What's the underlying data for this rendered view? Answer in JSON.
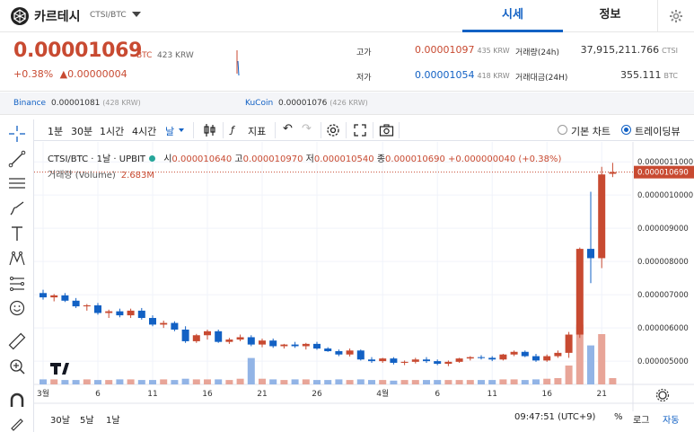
{
  "header": {
    "coin_name": "카르테시",
    "pair": "CTSI/BTC",
    "tab_market": "시세",
    "tab_info": "정보"
  },
  "price": {
    "current": "0.00001069",
    "unit": "BTC",
    "krw": "423 KRW",
    "change_pct": "+0.38%",
    "change_abs": "▲0.00000004"
  },
  "stats": {
    "high_label": "고가",
    "high_value": "0.00001097",
    "high_krw": "435 KRW",
    "low_label": "저가",
    "low_value": "0.00001054",
    "low_krw": "418 KRW",
    "volume_label": "거래량(24h)",
    "volume_value": "37,915,211.766",
    "volume_unit": "CTSI",
    "amount_label": "거래대금(24H)",
    "amount_value": "355.111",
    "amount_unit": "BTC"
  },
  "exchanges": [
    {
      "name": "Binance",
      "value": "0.00001081",
      "krw": "(428 KRW)"
    },
    {
      "name": "KuCoin",
      "value": "0.00001076",
      "krw": "(426 KRW)"
    }
  ],
  "toolbar": {
    "intervals": [
      "1분",
      "30분",
      "1시간",
      "4시간",
      "날"
    ],
    "indicators": "지표",
    "basic_chart": "기본 차트",
    "tradingview": "트레이딩뷰"
  },
  "legend": {
    "symbol": "CTSI/BTC · 1날 · UPBIT",
    "open_label": "시",
    "open": "0.000010640",
    "high_label": "고",
    "high": "0.000010970",
    "low_label": "저",
    "low": "0.000010540",
    "close_label": "종",
    "close": "0.000010690",
    "change": "+0.000000040 (+0.38%)",
    "volume_label": "거래량 (Volume)",
    "volume_value": "2.683M"
  },
  "bottom": {
    "ranges": [
      "30날",
      "5날",
      "1날"
    ],
    "time": "09:47:51 (UTC+9)",
    "pct": "%",
    "log": "로그",
    "auto": "자동"
  },
  "chart_data": {
    "type": "candlestick",
    "y_ticks": [
      "0.0000011000",
      "0.0000010000",
      "0.000009000",
      "0.000008000",
      "0.000007000",
      "0.000006000",
      "0.000005000"
    ],
    "y_tick_values": [
      11.0,
      10.0,
      9.0,
      8.0,
      7.0,
      6.0,
      5.0
    ],
    "last_price_label": "0.000010690",
    "last_price": 10.69,
    "x_tick_labels": [
      "3월",
      "6",
      "11",
      "16",
      "21",
      "26",
      "4월",
      "6",
      "11",
      "16",
      "21"
    ],
    "x_tick_days": [
      1,
      6,
      11,
      16,
      21,
      26,
      32,
      37,
      42,
      47,
      52
    ],
    "ylim": [
      4.3,
      11.6
    ],
    "units_note": "y values are in units of 1e-6 BTC",
    "up_color": "#c84a31",
    "down_color": "#1261c4",
    "candles": [
      [
        0,
        7.05,
        7.15,
        6.85,
        6.92
      ],
      [
        1,
        6.92,
        7.02,
        6.8,
        6.98
      ],
      [
        2,
        6.98,
        7.05,
        6.78,
        6.82
      ],
      [
        3,
        6.82,
        6.9,
        6.6,
        6.65
      ],
      [
        4,
        6.65,
        6.72,
        6.52,
        6.68
      ],
      [
        5,
        6.68,
        6.75,
        6.4,
        6.45
      ],
      [
        6,
        6.45,
        6.55,
        6.3,
        6.5
      ],
      [
        7,
        6.5,
        6.58,
        6.32,
        6.38
      ],
      [
        8,
        6.38,
        6.58,
        6.3,
        6.52
      ],
      [
        9,
        6.52,
        6.6,
        6.25,
        6.3
      ],
      [
        10,
        6.3,
        6.38,
        6.05,
        6.1
      ],
      [
        11,
        6.1,
        6.22,
        6.0,
        6.15
      ],
      [
        12,
        6.15,
        6.2,
        5.9,
        5.95
      ],
      [
        13,
        5.95,
        6.05,
        5.55,
        5.6
      ],
      [
        14,
        5.6,
        5.82,
        5.55,
        5.78
      ],
      [
        15,
        5.78,
        5.95,
        5.65,
        5.9
      ],
      [
        16,
        5.9,
        5.95,
        5.55,
        5.58
      ],
      [
        17,
        5.58,
        5.7,
        5.52,
        5.65
      ],
      [
        18,
        5.65,
        5.8,
        5.6,
        5.72
      ],
      [
        19,
        5.72,
        5.78,
        5.45,
        5.5
      ],
      [
        20,
        5.5,
        5.68,
        5.42,
        5.62
      ],
      [
        21,
        5.62,
        5.68,
        5.4,
        5.45
      ],
      [
        22,
        5.45,
        5.52,
        5.38,
        5.5
      ],
      [
        23,
        5.5,
        5.58,
        5.4,
        5.45
      ],
      [
        24,
        5.45,
        5.55,
        5.35,
        5.52
      ],
      [
        25,
        5.52,
        5.58,
        5.34,
        5.38
      ],
      [
        26,
        5.38,
        5.42,
        5.28,
        5.3
      ],
      [
        27,
        5.3,
        5.35,
        5.15,
        5.2
      ],
      [
        28,
        5.2,
        5.38,
        5.14,
        5.32
      ],
      [
        29,
        5.32,
        5.35,
        5.02,
        5.05
      ],
      [
        30,
        5.05,
        5.12,
        4.95,
        5.0
      ],
      [
        31,
        5.0,
        5.1,
        4.95,
        5.08
      ],
      [
        32,
        5.08,
        5.12,
        4.9,
        4.95
      ],
      [
        33,
        4.95,
        5.02,
        4.88,
        4.98
      ],
      [
        34,
        4.98,
        5.1,
        4.93,
        5.05
      ],
      [
        35,
        5.05,
        5.12,
        4.95,
        5.0
      ],
      [
        36,
        5.0,
        5.05,
        4.88,
        4.92
      ],
      [
        37,
        4.92,
        5.02,
        4.85,
        4.98
      ],
      [
        38,
        4.98,
        5.1,
        4.95,
        5.08
      ],
      [
        39,
        5.08,
        5.15,
        5.02,
        5.12
      ],
      [
        40,
        5.12,
        5.18,
        5.05,
        5.1
      ],
      [
        41,
        5.1,
        5.15,
        5.0,
        5.05
      ],
      [
        42,
        5.05,
        5.22,
        5.02,
        5.2
      ],
      [
        43,
        5.2,
        5.32,
        5.15,
        5.28
      ],
      [
        44,
        5.28,
        5.32,
        5.12,
        5.15
      ],
      [
        45,
        5.15,
        5.22,
        4.98,
        5.02
      ],
      [
        46,
        5.02,
        5.2,
        4.98,
        5.15
      ],
      [
        47,
        5.15,
        5.32,
        5.1,
        5.25
      ],
      [
        48,
        5.25,
        5.88,
        5.1,
        5.8
      ],
      [
        49,
        5.8,
        8.42,
        5.7,
        8.38
      ],
      [
        50,
        8.38,
        10.1,
        7.35,
        8.1
      ],
      [
        51,
        8.1,
        10.85,
        7.8,
        10.62
      ],
      [
        52,
        10.64,
        10.97,
        10.54,
        10.69
      ]
    ],
    "volumes": [
      0.08,
      0.08,
      0.07,
      0.07,
      0.08,
      0.07,
      0.07,
      0.08,
      0.08,
      0.07,
      0.07,
      0.08,
      0.07,
      0.09,
      0.08,
      0.08,
      0.08,
      0.07,
      0.09,
      0.42,
      0.09,
      0.08,
      0.07,
      0.08,
      0.08,
      0.07,
      0.07,
      0.08,
      0.07,
      0.08,
      0.07,
      0.07,
      0.06,
      0.07,
      0.07,
      0.07,
      0.07,
      0.07,
      0.07,
      0.07,
      0.07,
      0.07,
      0.08,
      0.08,
      0.07,
      0.08,
      0.09,
      0.1,
      0.3,
      0.95,
      0.62,
      0.8,
      0.1
    ]
  }
}
